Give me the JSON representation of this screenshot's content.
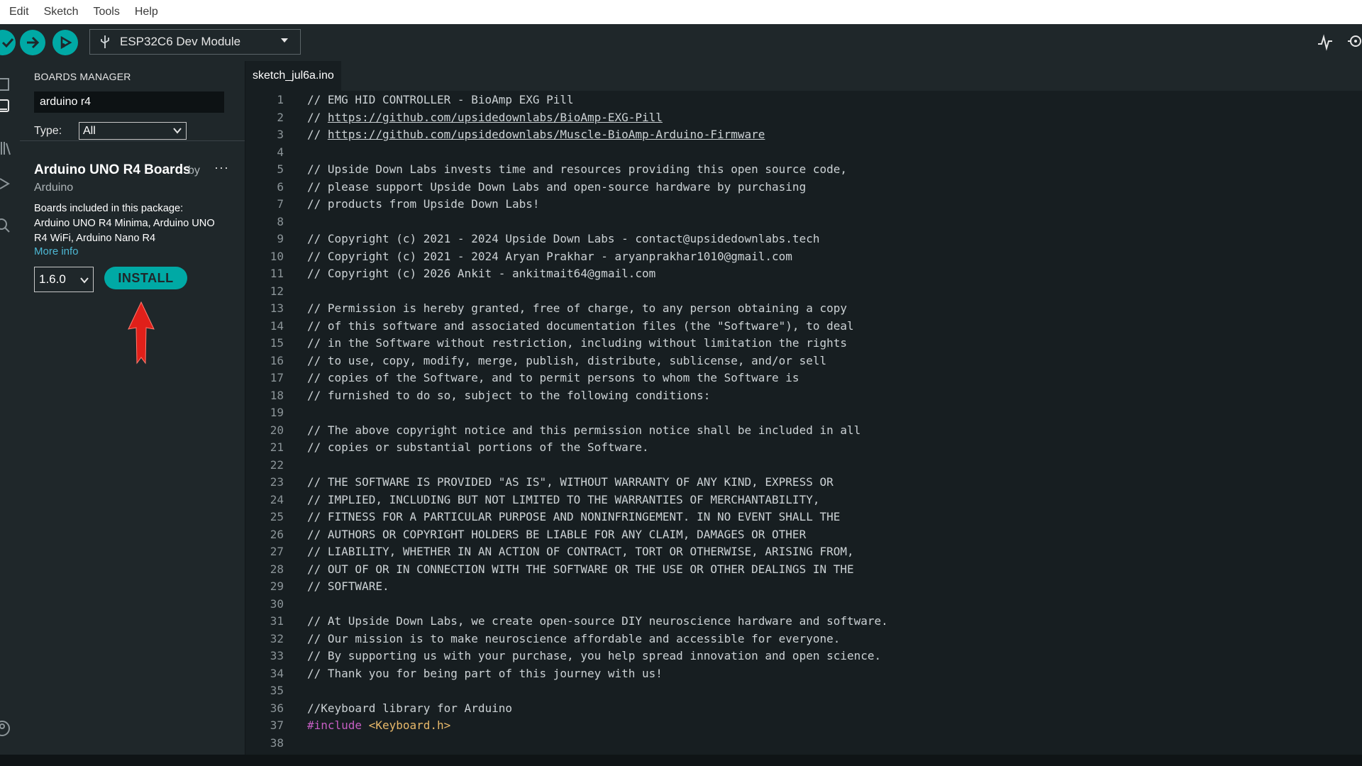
{
  "menu": [
    "Edit",
    "Sketch",
    "Tools",
    "Help"
  ],
  "toolbar": {
    "verify_icon": "check-icon",
    "upload_icon": "arrow-right-icon",
    "debug_icon": "debug-icon",
    "board_select": "ESP32C6 Dev Module",
    "serial_plotter_icon": "serial-plotter-icon",
    "serial_monitor_icon": "serial-monitor-icon"
  },
  "sidebar": {
    "title": "BOARDS MANAGER",
    "search_value": "arduino r4",
    "type_label": "Type:",
    "type_value": "All",
    "board_name": "Arduino UNO R4 Boards",
    "by": "by",
    "more": "···",
    "author": "Arduino",
    "description": "Boards included in this package: Arduino UNO R4 Minima, Arduino UNO R4 WiFi, Arduino Nano R4",
    "more_info": "More info",
    "version": "1.6.0",
    "install_label": "INSTALL"
  },
  "editor": {
    "tab": "sketch_jul6a.ino",
    "lines": [
      "// EMG HID CONTROLLER - BioAmp EXG Pill",
      "// https://github.com/upsidedownlabs/BioAmp-EXG-Pill",
      "// https://github.com/upsidedownlabs/Muscle-BioAmp-Arduino-Firmware",
      "",
      "// Upside Down Labs invests time and resources providing this open source code,",
      "// please support Upside Down Labs and open-source hardware by purchasing",
      "// products from Upside Down Labs!",
      "",
      "// Copyright (c) 2021 - 2024 Upside Down Labs - contact@upsidedownlabs.tech",
      "// Copyright (c) 2021 - 2024 Aryan Prakhar - aryanprakhar1010@gmail.com",
      "// Copyright (c) 2026 Ankit - ankitmait64@gmail.com",
      "",
      "// Permission is hereby granted, free of charge, to any person obtaining a copy",
      "// of this software and associated documentation files (the \"Software\"), to deal",
      "// in the Software without restriction, including without limitation the rights",
      "// to use, copy, modify, merge, publish, distribute, sublicense, and/or sell",
      "// copies of the Software, and to permit persons to whom the Software is",
      "// furnished to do so, subject to the following conditions:",
      "",
      "// The above copyright notice and this permission notice shall be included in all",
      "// copies or substantial portions of the Software.",
      "",
      "// THE SOFTWARE IS PROVIDED \"AS IS\", WITHOUT WARRANTY OF ANY KIND, EXPRESS OR",
      "// IMPLIED, INCLUDING BUT NOT LIMITED TO THE WARRANTIES OF MERCHANTABILITY,",
      "// FITNESS FOR A PARTICULAR PURPOSE AND NONINFRINGEMENT. IN NO EVENT SHALL THE",
      "// AUTHORS OR COPYRIGHT HOLDERS BE LIABLE FOR ANY CLAIM, DAMAGES OR OTHER",
      "// LIABILITY, WHETHER IN AN ACTION OF CONTRACT, TORT OR OTHERWISE, ARISING FROM,",
      "// OUT OF OR IN CONNECTION WITH THE SOFTWARE OR THE USE OR OTHER DEALINGS IN THE",
      "// SOFTWARE.",
      "",
      "// At Upside Down Labs, we create open-source DIY neuroscience hardware and software.",
      "// Our mission is to make neuroscience affordable and accessible for everyone.",
      "// By supporting us with your purchase, you help spread innovation and open science.",
      "// Thank you for being part of this journey with us!",
      "",
      "//Keyboard library for Arduino",
      "#include <Keyboard.h>",
      ""
    ]
  },
  "colors": {
    "accent": "#00a9a5",
    "link": "#4db7d3",
    "keyword": "#c65ec3",
    "header_file": "#e8b96a",
    "annotation_arrow": "#e0201a"
  }
}
